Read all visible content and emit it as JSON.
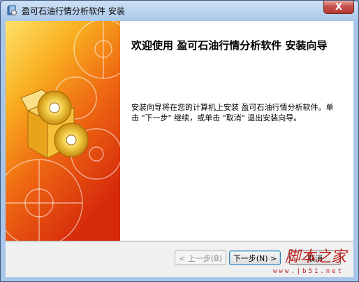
{
  "window": {
    "title": "盈可石油行情分析软件 安装",
    "close_glyph": "X"
  },
  "welcome": {
    "heading": "欢迎使用  盈可石油行情分析软件  安装向导",
    "description": "安装向导将在您的计算机上安装 盈可石油行情分析软件。单击 \"下一步\" 继续，或单击 \"取消\" 退出安装向导。"
  },
  "buttons": {
    "back": "< 上一步(B)",
    "next": "下一步(N) >",
    "cancel": "取消"
  },
  "watermark": {
    "text": "脚本之家",
    "url": "www.jb51.net"
  },
  "colors": {
    "banner_orange": "#f7a21a",
    "banner_red": "#d92b0e",
    "banner_yellow": "#fcd232",
    "watermark_red": "#c0201c"
  },
  "icons": {
    "app": "installer-icon",
    "hero": "package-with-discs-icon"
  }
}
